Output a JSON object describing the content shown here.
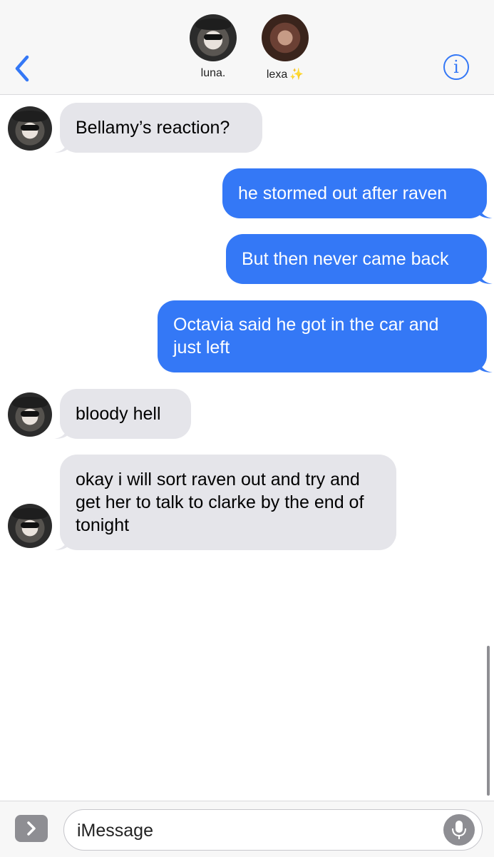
{
  "header": {
    "contacts": [
      {
        "name": "luna.",
        "decoration": ""
      },
      {
        "name": "lexa",
        "decoration": "✨"
      }
    ],
    "back_icon": "chevron-left-icon",
    "info_icon": "info-icon",
    "info_glyph": "i"
  },
  "colors": {
    "accent": "#3478f6",
    "incoming_bubble": "#e5e5ea",
    "outgoing_bubble": "#3478f6"
  },
  "messages": [
    {
      "direction": "incoming",
      "sender": "luna.",
      "text": "Bellamy’s reaction?"
    },
    {
      "direction": "outgoing",
      "text": "he stormed out after raven"
    },
    {
      "direction": "outgoing",
      "text": "But then never came back"
    },
    {
      "direction": "outgoing",
      "text": "Octavia said he got in the car and just left"
    },
    {
      "direction": "incoming",
      "sender": "luna.",
      "text": "bloody hell"
    },
    {
      "direction": "incoming",
      "sender": "luna.",
      "text": "okay i will sort raven out and try and get her to talk to clarke by the end of tonight"
    }
  ],
  "input_bar": {
    "placeholder": "iMessage",
    "apps_icon": "chevron-right-icon",
    "mic_icon": "microphone-icon"
  }
}
